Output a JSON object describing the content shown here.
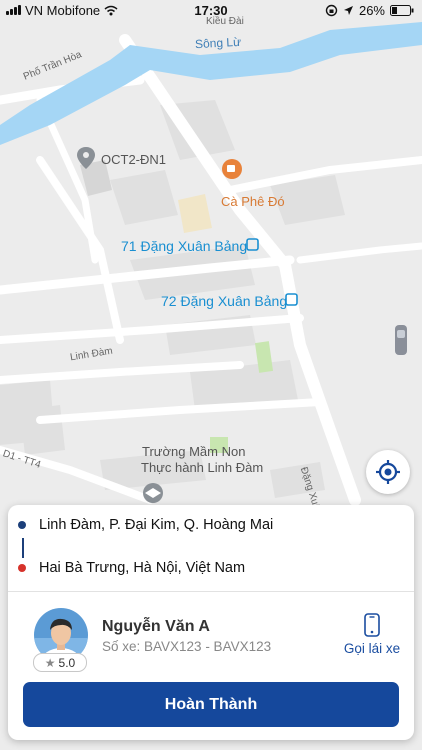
{
  "status_bar": {
    "carrier": "VN Mobifone",
    "time": "17:30",
    "battery": "26%"
  },
  "map": {
    "labels": {
      "street_kieu_dai": "Kiều Đài",
      "river": "Sông Lừ",
      "street_tran_hoa": "Phố Trần Hòa",
      "oct2": "OCT2-ĐN1",
      "cafe": "Cà Phê Đó",
      "poi_71": "71 Đặng Xuân Bảng",
      "poi_72": "72 Đặng Xuân Bảng",
      "street_linh_dam": "Linh Đàm",
      "street_d1": "D1 - TT4",
      "school_line1": "Trường Mầm Non",
      "school_line2": "Thực hành Linh Đàm",
      "street_dang_xuan_bang": "Đặng Xuân Bảng"
    }
  },
  "trip": {
    "pickup": "Linh Đàm, P. Đại Kim, Q. Hoàng Mai",
    "dropoff": "Hai Bà Trưng, Hà Nội, Việt Nam",
    "pickup_color": "#1c3f7a",
    "dropoff_color": "#d6322b"
  },
  "driver": {
    "name": "Nguyễn Văn A",
    "plate": "Số xe: BAVX123 - BAVX123",
    "rating": "5.0",
    "call_label": "Gọi lái xe"
  },
  "actions": {
    "finish_label": "Hoàn Thành",
    "finish_color": "#15489c"
  }
}
